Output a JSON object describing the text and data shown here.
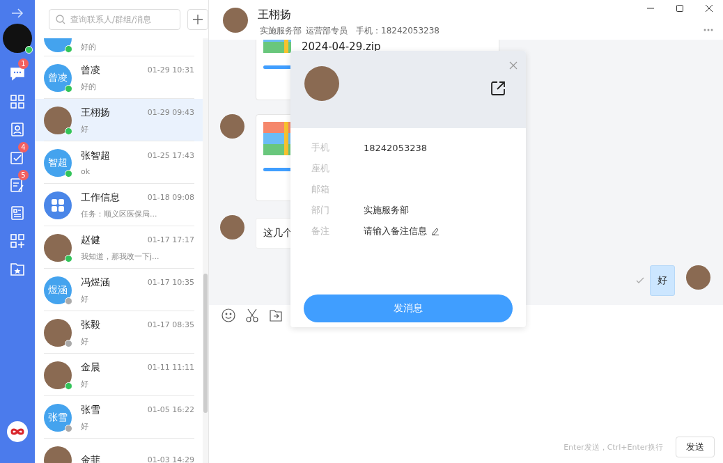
{
  "nav": {
    "user_online": true,
    "items": [
      {
        "kind": "chat",
        "badge": "1"
      },
      {
        "kind": "apps"
      },
      {
        "kind": "contacts"
      },
      {
        "kind": "tasks",
        "badge": "4"
      },
      {
        "kind": "notes",
        "badge": "5"
      },
      {
        "kind": "news"
      },
      {
        "kind": "add-app"
      },
      {
        "kind": "favorites"
      }
    ]
  },
  "search": {
    "placeholder": "查询联系人/群组/消息"
  },
  "contacts": [
    {
      "avatar": {
        "kind": "text"
      },
      "preview": "好的",
      "online": true,
      "selected": false
    },
    {
      "avatar": {
        "kind": "text",
        "text": "曾凌"
      },
      "name": "曾凌",
      "time": "01-29 10:31",
      "preview": "好的",
      "online": true,
      "selected": false
    },
    {
      "avatar": {
        "kind": "photo"
      },
      "name": "王栩扬",
      "time": "01-29 09:43",
      "preview": "好",
      "online": true,
      "selected": true
    },
    {
      "avatar": {
        "kind": "text",
        "text": "智超"
      },
      "name": "张智超",
      "time": "01-25 17:43",
      "preview": "ok",
      "online": true,
      "selected": false
    },
    {
      "avatar": {
        "kind": "app"
      },
      "name": "工作信息",
      "time": "01-18 09:08",
      "preview": "任务：顺义区医保局...",
      "selected": false
    },
    {
      "avatar": {
        "kind": "photo"
      },
      "name": "赵健",
      "time": "01-17 17:17",
      "preview": "我知道，那我改一下j...",
      "online": true,
      "selected": false
    },
    {
      "avatar": {
        "kind": "text",
        "text": "煜涵"
      },
      "name": "冯煜涵",
      "time": "01-17 10:35",
      "preview": "好",
      "online": false,
      "selected": false
    },
    {
      "avatar": {
        "kind": "photo"
      },
      "name": "张毅",
      "time": "01-17 08:35",
      "preview": "好",
      "online": false,
      "selected": false
    },
    {
      "avatar": {
        "kind": "photo"
      },
      "name": "金晨",
      "time": "01-11 11:11",
      "preview": "好",
      "online": true,
      "selected": false
    },
    {
      "avatar": {
        "kind": "text",
        "text": "张雪"
      },
      "name": "张雪",
      "time": "01-05 16:22",
      "preview": "好",
      "online": false,
      "selected": false
    },
    {
      "avatar": {
        "kind": "photo"
      },
      "name": "金菲",
      "time": "01-03 14:29",
      "selected": false
    }
  ],
  "chat": {
    "name": "王栩扬",
    "department": "实施服务部",
    "role": "运营部专员",
    "phone": "手机：18242053238",
    "messages": [
      {
        "kind": "file",
        "file_name": "2024-04-29.zip",
        "level": 1
      },
      {
        "kind": "file",
        "level": 1
      },
      {
        "kind": "text",
        "text": "这几个"
      },
      {
        "kind": "own-text",
        "text": "好",
        "read": true
      }
    ]
  },
  "profile": {
    "fields": [
      {
        "label": "手机",
        "value": "18242053238"
      },
      {
        "label": "座机"
      },
      {
        "label": "邮箱"
      },
      {
        "label": "部门",
        "value": "实施服务部"
      },
      {
        "label": "备注",
        "placeholder": "请输入备注信息",
        "editable": true
      }
    ],
    "button": "发消息"
  },
  "composer": {
    "hint": "Enter发送，Ctrl+Enter换行",
    "send": "发送"
  }
}
